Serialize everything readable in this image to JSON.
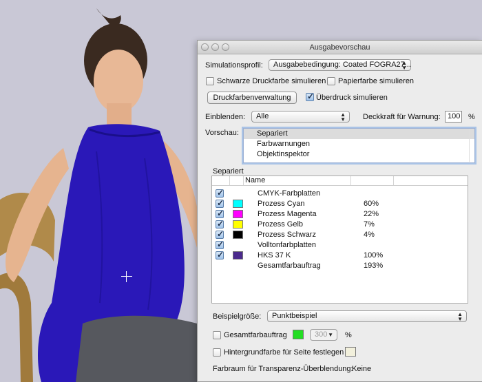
{
  "window": {
    "title": "Ausgabevorschau"
  },
  "simulation": {
    "profile_label": "Simulationsprofil:",
    "profile_value": "Ausgabebedingung: Coated FOGRA27...",
    "black_ink_label": "Schwarze Druckfarbe simulieren",
    "black_ink_checked": false,
    "paper_color_label": "Papierfarbe simulieren",
    "paper_color_checked": false,
    "ink_manager_button": "Druckfarbenverwaltung",
    "overprint_label": "Überdruck simulieren",
    "overprint_checked": true
  },
  "show": {
    "label": "Einblenden:",
    "value": "Alle",
    "opacity_label": "Deckkraft für Warnung:",
    "opacity_value": "100",
    "opacity_unit": "%"
  },
  "preview": {
    "label": "Vorschau:",
    "items": [
      "Separiert",
      "Farbwarnungen",
      "Objektinspektor"
    ],
    "selected": "Separiert"
  },
  "separations": {
    "group_title": "Separiert",
    "column_name": "Name",
    "rows": [
      {
        "checked": true,
        "name": "CMYK-Farbplatten",
        "swatch": "",
        "percent": ""
      },
      {
        "checked": true,
        "name": "Prozess Cyan",
        "swatch": "#00ffff",
        "percent": "60%"
      },
      {
        "checked": true,
        "name": "Prozess Magenta",
        "swatch": "#ff00ff",
        "percent": "22%"
      },
      {
        "checked": true,
        "name": "Prozess Gelb",
        "swatch": "#ffff00",
        "percent": "7%"
      },
      {
        "checked": true,
        "name": "Prozess Schwarz",
        "swatch": "#000000",
        "percent": "4%"
      },
      {
        "checked": true,
        "name": "Volltonfarbplatten",
        "swatch": "",
        "percent": ""
      },
      {
        "checked": true,
        "name": "HKS 37 K",
        "swatch": "#4b2a8c",
        "percent": "100%"
      },
      {
        "checked": null,
        "name": "Gesamtfarbauftrag",
        "swatch": "",
        "percent": "193%"
      }
    ]
  },
  "sample": {
    "size_label": "Beispielgröße:",
    "size_value": "Punktbeispiel",
    "total_ink_label": "Gesamtfarbauftrag",
    "total_ink_checked": false,
    "total_ink_color": "#22dd22",
    "total_ink_value": "300",
    "total_ink_unit": "%",
    "page_bg_label": "Hintergrundfarbe für Seite festlegen",
    "page_bg_checked": false,
    "page_bg_color": "#f2f0dc",
    "transparency_label": "Farbraum für Transparenz-Überblendung:",
    "transparency_value": "Keine"
  },
  "colors": {
    "dress": "#2a18b8",
    "background": "#c9c8d6"
  }
}
